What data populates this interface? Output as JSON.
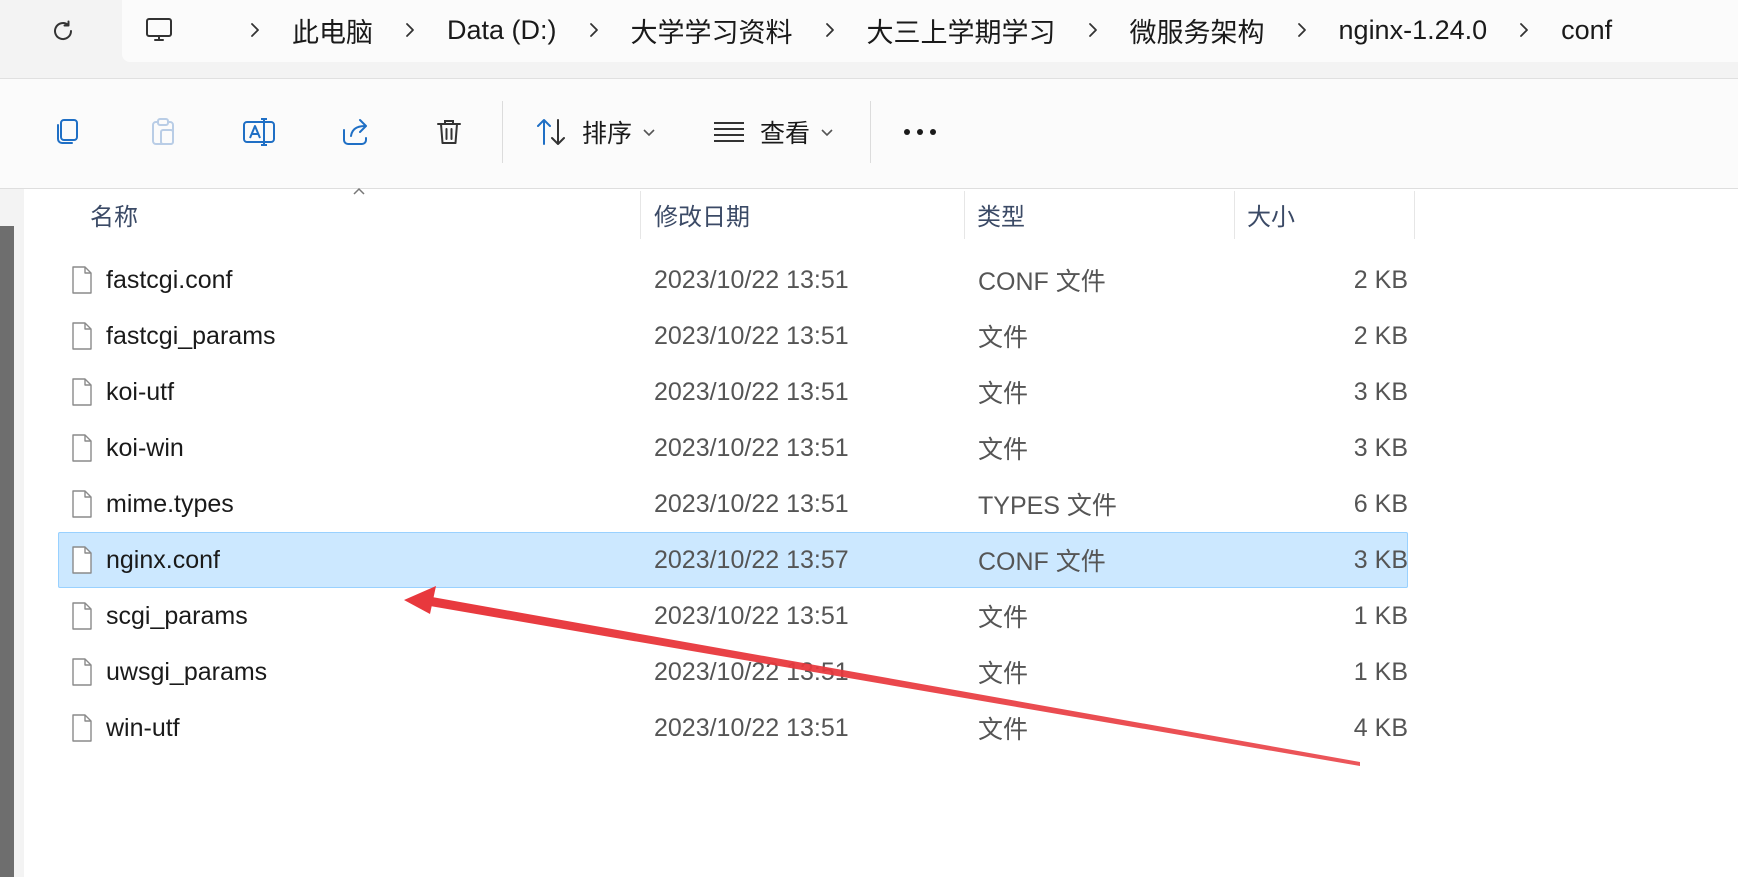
{
  "address_bar": {
    "breadcrumbs": [
      "此电脑",
      "Data (D:)",
      "大学学习资料",
      "大三上学期学习",
      "微服务架构",
      "nginx-1.24.0",
      "conf"
    ]
  },
  "toolbar": {
    "sort_label": "排序",
    "view_label": "查看"
  },
  "file_list": {
    "columns": {
      "name": "名称",
      "date": "修改日期",
      "type": "类型",
      "size": "大小"
    },
    "rows": [
      {
        "name": "fastcgi.conf",
        "date": "2023/10/22 13:51",
        "type": "CONF 文件",
        "size": "2 KB"
      },
      {
        "name": "fastcgi_params",
        "date": "2023/10/22 13:51",
        "type": "文件",
        "size": "2 KB"
      },
      {
        "name": "koi-utf",
        "date": "2023/10/22 13:51",
        "type": "文件",
        "size": "3 KB"
      },
      {
        "name": "koi-win",
        "date": "2023/10/22 13:51",
        "type": "文件",
        "size": "3 KB"
      },
      {
        "name": "mime.types",
        "date": "2023/10/22 13:51",
        "type": "TYPES 文件",
        "size": "6 KB"
      },
      {
        "name": "nginx.conf",
        "date": "2023/10/22 13:57",
        "type": "CONF 文件",
        "size": "3 KB",
        "selected": true
      },
      {
        "name": "scgi_params",
        "date": "2023/10/22 13:51",
        "type": "文件",
        "size": "1 KB"
      },
      {
        "name": "uwsgi_params",
        "date": "2023/10/22 13:51",
        "type": "文件",
        "size": "1 KB"
      },
      {
        "name": "win-utf",
        "date": "2023/10/22 13:51",
        "type": "文件",
        "size": "4 KB"
      }
    ]
  },
  "colors": {
    "selection": "#cce8ff",
    "annotation_arrow": "#e8383d",
    "accent_icon": "#1f6fc5"
  }
}
